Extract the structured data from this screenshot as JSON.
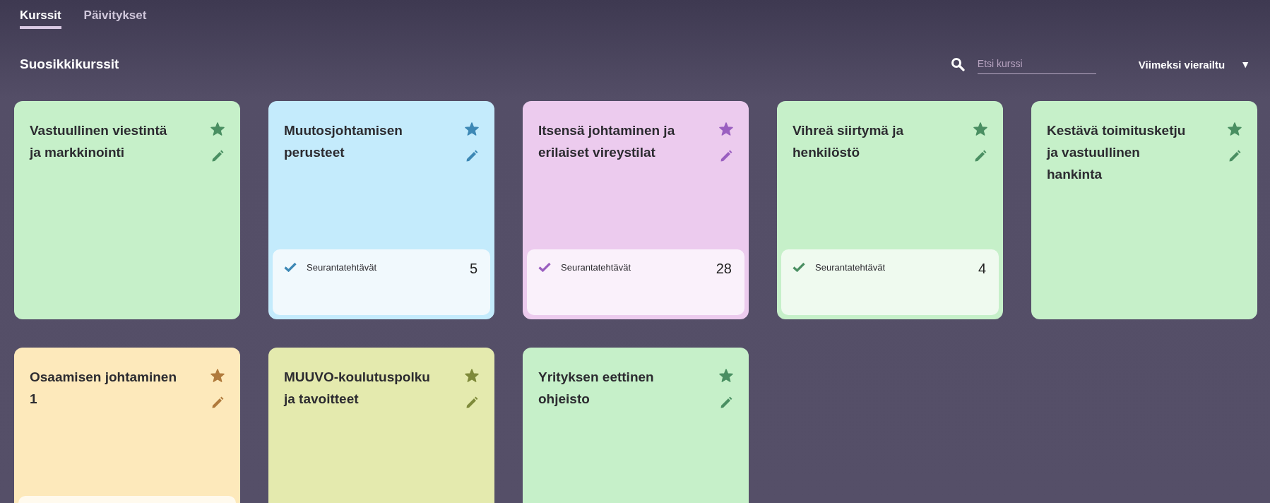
{
  "tabs": [
    {
      "label": "Kurssit",
      "selected": true
    },
    {
      "label": "Päivitykset",
      "selected": false
    }
  ],
  "section_title": "Suosikkikurssit",
  "search": {
    "placeholder": "Etsi kurssi"
  },
  "sort": {
    "label": "Viimeksi vierailtu",
    "symbol": "▼"
  },
  "courses": [
    {
      "title": "Vastuullinen viestintä ja markkinointi",
      "color": "#4a8f62",
      "favorite": true,
      "panel": false
    },
    {
      "title": "Muutosjohtamisen perusteet",
      "color": "#3d88b5",
      "favorite": true,
      "panel": true,
      "tracker": {
        "label": "Seurantatehtävät",
        "count": "5"
      }
    },
    {
      "title": "Itsensä johtaminen ja erilaiset vireystilat",
      "color": "#9a5fc0",
      "favorite": true,
      "panel": true,
      "tracker": {
        "label": "Seurantatehtävät",
        "count": "28"
      }
    },
    {
      "title": "Vihreä siirtymä ja henkilöstö",
      "color": "#4a8f62",
      "favorite": true,
      "panel": true,
      "tracker": {
        "label": "Seurantatehtävät",
        "count": "4"
      }
    },
    {
      "title": "Kestävä toimitusketju ja vastuullinen hankinta",
      "color": "#4a8f62",
      "favorite": true,
      "panel": false
    },
    {
      "title": "Osaamisen johtaminen 1",
      "color": "#b07a3c",
      "favorite": true,
      "panel": true
    },
    {
      "title": "MUUVO-koulutuspolku ja tavoitteet",
      "color": "#7e8a3a",
      "favorite": true,
      "panel": false
    },
    {
      "title": "Yrityksen eettinen ohjeisto",
      "color": "#4a8f62",
      "favorite": true,
      "panel": false
    }
  ]
}
